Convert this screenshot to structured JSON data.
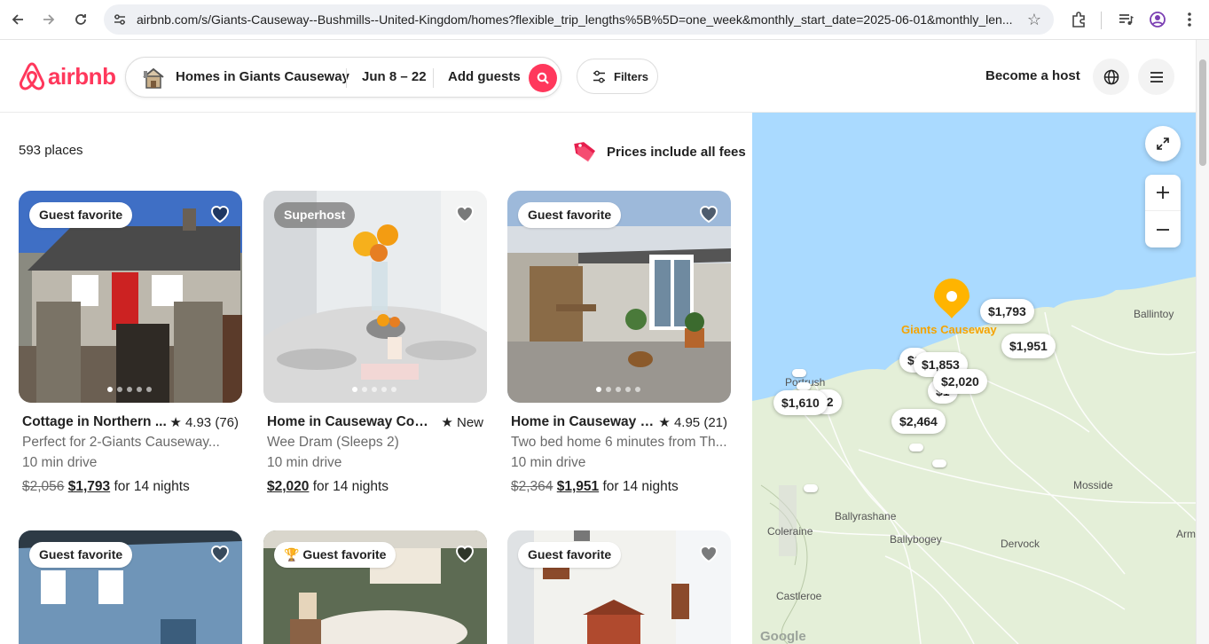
{
  "browser": {
    "url": "airbnb.com/s/Giants-Causeway--Bushmills--United-Kingdom/homes?flexible_trip_lengths%5B%5D=one_week&monthly_start_date=2025-06-01&monthly_len..."
  },
  "header": {
    "brand": "airbnb",
    "search": {
      "where": "Homes in Giants Causeway",
      "dates": "Jun 8 – 22",
      "guests": "Add guests"
    },
    "filters_label": "Filters",
    "become_host": "Become a host"
  },
  "results": {
    "count": "593 places",
    "fees_note": "Prices include all fees"
  },
  "listings": [
    {
      "badge": "Guest favorite",
      "title": "Cottage in Northern ...",
      "rating": "★ 4.93 (76)",
      "subtitle": "Perfect for 2-Giants Causeway...",
      "distance": "10 min drive",
      "old_price": "$2,056",
      "price": "$1,793",
      "per": "for 14 nights"
    },
    {
      "badge": "Superhost",
      "title": "Home in Causeway Coas...",
      "rating": "★ New",
      "subtitle": "Wee Dram (Sleeps 2)",
      "distance": "10 min drive",
      "old_price": "",
      "price": "$2,020",
      "per": "for 14 nights"
    },
    {
      "badge": "Guest favorite",
      "title": "Home in Causeway C...",
      "rating": "★ 4.95 (21)",
      "subtitle": "Two bed home 6 minutes from Th...",
      "distance": "10 min drive",
      "old_price": "$2,364",
      "price": "$1,951",
      "per": "for 14 nights"
    },
    {
      "badge": "Guest favorite"
    },
    {
      "badge": "Guest favorite"
    },
    {
      "badge": "Guest favorite"
    }
  ],
  "map": {
    "landmark": "Giants Causeway",
    "prices": [
      "$1,793",
      "$1,951",
      "$1,853",
      "$2,020",
      "$1,610",
      "$2,464"
    ],
    "places": [
      "Ballintoy",
      "Portrush",
      "Mosside",
      "Ballyrashane",
      "Coleraine",
      "Ballybogey",
      "Dervock",
      "Armoy",
      "Castleroe"
    ],
    "attribution": "Google"
  },
  "colors": {
    "brand": "#ff385c",
    "map_sea": "#aadaff",
    "map_land": "#e6f0da",
    "landmark": "#ffb400"
  },
  "icons": [
    "back-arrow-icon",
    "forward-arrow-icon",
    "reload-icon",
    "site-info-icon",
    "bookmark-star-icon",
    "extensions-icon",
    "media-icon",
    "profile-icon",
    "kebab-menu-icon",
    "search-icon",
    "filters-icon",
    "globe-icon",
    "hamburger-icon",
    "heart-icon",
    "expand-icon",
    "zoom-in-icon",
    "zoom-out-icon",
    "trophy-icon",
    "price-tag-icon"
  ]
}
